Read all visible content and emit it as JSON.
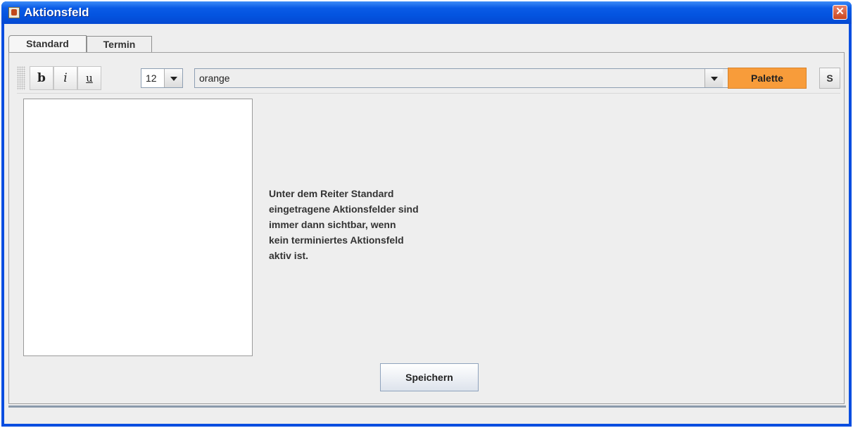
{
  "window": {
    "title": "Aktionsfeld",
    "close_label": "✕"
  },
  "tabs": [
    {
      "label": "Standard",
      "active": true
    },
    {
      "label": "Termin",
      "active": false
    }
  ],
  "toolbar": {
    "bold_label": "b",
    "italic_label": "i",
    "underline_label": "u",
    "font_size": "12",
    "color_value": "orange",
    "palette_label": "Palette",
    "s_label": "S",
    "palette_color": "#f89c3a"
  },
  "info_lines": [
    "Unter dem Reiter Standard",
    "eingetragene Aktionsfelder sind",
    "immer dann sichtbar, wenn",
    "kein terminiertes Aktionsfeld",
    "aktiv ist."
  ],
  "save_label": "Speichern",
  "icons": {
    "app": "java-app-icon",
    "close": "close-icon",
    "dropdown": "chevron-down-icon",
    "grip": "toolbar-grip-icon"
  }
}
